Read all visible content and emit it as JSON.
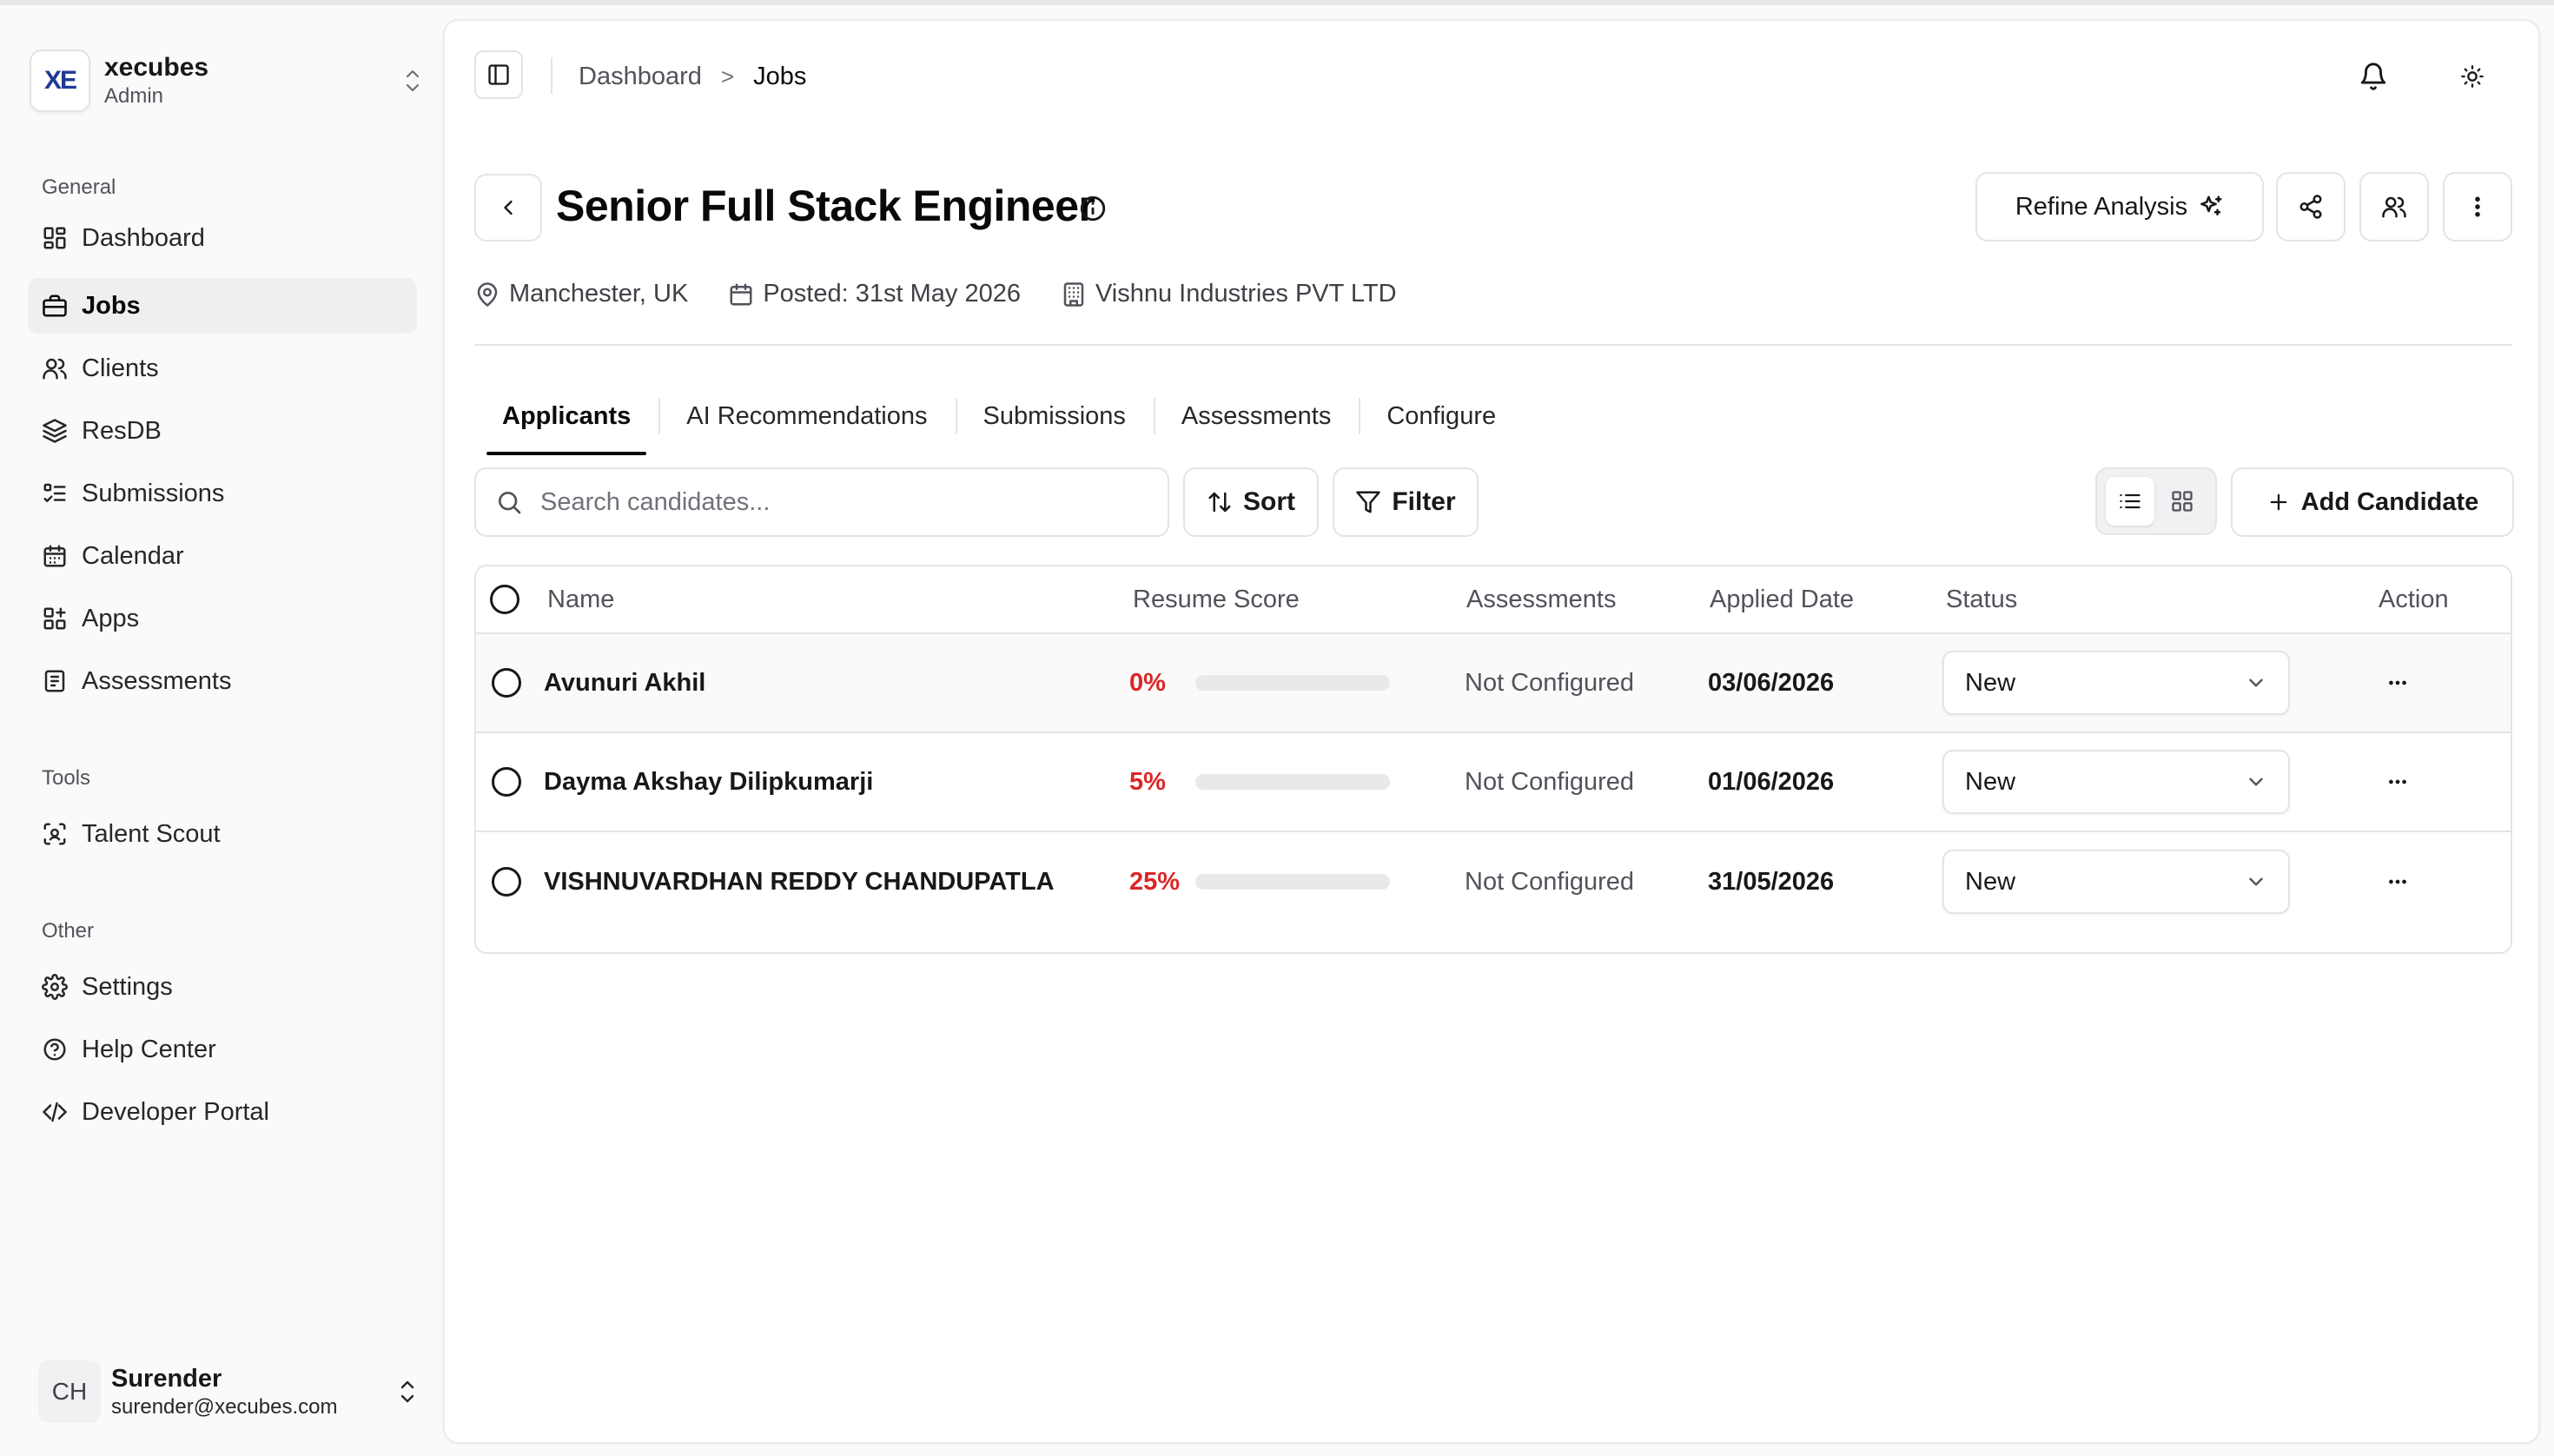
{
  "workspace": {
    "logo": "XE",
    "name": "xecubes",
    "role": "Admin"
  },
  "sidebar": {
    "groups": [
      {
        "label": "General",
        "items": [
          {
            "label": "Dashboard",
            "icon": "dashboard-icon"
          },
          {
            "label": "Jobs",
            "icon": "briefcase-icon",
            "active": true
          },
          {
            "label": "Clients",
            "icon": "users-icon"
          },
          {
            "label": "ResDB",
            "icon": "layers-icon"
          },
          {
            "label": "Submissions",
            "icon": "list-checks-icon"
          },
          {
            "label": "Calendar",
            "icon": "calendar-icon"
          },
          {
            "label": "Apps",
            "icon": "apps-icon"
          },
          {
            "label": "Assessments",
            "icon": "clipboard-icon"
          }
        ]
      },
      {
        "label": "Tools",
        "items": [
          {
            "label": "Talent Scout",
            "icon": "scan-face-icon"
          }
        ]
      },
      {
        "label": "Other",
        "items": [
          {
            "label": "Settings",
            "icon": "gear-icon"
          },
          {
            "label": "Help Center",
            "icon": "help-circle-icon"
          },
          {
            "label": "Developer Portal",
            "icon": "code-icon"
          }
        ]
      }
    ]
  },
  "user": {
    "initials": "CH",
    "name": "Surender",
    "email": "surender@xecubes.com"
  },
  "breadcrumb": {
    "parent": "Dashboard",
    "separator": ">",
    "current": "Jobs"
  },
  "job": {
    "title": "Senior Full Stack Engineer",
    "location": "Manchester, UK",
    "posted": "Posted: 31st May 2026",
    "company": "Vishnu Industries PVT LTD"
  },
  "actions": {
    "refine_label": "Refine Analysis"
  },
  "tabs": [
    "Applicants",
    "AI Recommendations",
    "Submissions",
    "Assessments",
    "Configure"
  ],
  "toolbar": {
    "search_placeholder": "Search candidates...",
    "sort_label": "Sort",
    "filter_label": "Filter",
    "add_label": "Add Candidate"
  },
  "table": {
    "headers": {
      "name": "Name",
      "score": "Resume Score",
      "assessments": "Assessments",
      "applied": "Applied Date",
      "status": "Status",
      "action": "Action"
    },
    "rows": [
      {
        "name": "Avunuri Akhil",
        "score_text": "0%",
        "score": 0,
        "assessments": "Not Configured",
        "applied": "03/06/2026",
        "status": "New"
      },
      {
        "name": "Dayma Akshay Dilipkumarji",
        "score_text": "5%",
        "score": 5,
        "assessments": "Not Configured",
        "applied": "01/06/2026",
        "status": "New"
      },
      {
        "name": "VISHNUVARDHAN REDDY CHANDUPATLA",
        "score_text": "25%",
        "score": 25,
        "assessments": "Not Configured",
        "applied": "31/05/2026",
        "status": "New"
      }
    ]
  },
  "colors": {
    "score": "#dc2626",
    "score_bar": "#f87171",
    "logo": "#1f3a93"
  }
}
